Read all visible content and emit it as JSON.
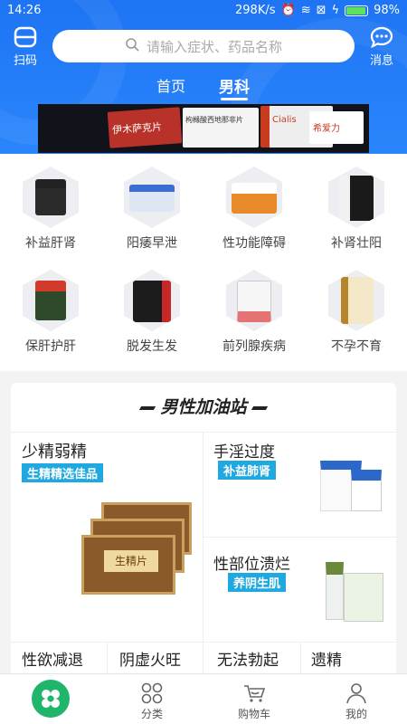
{
  "status": {
    "time": "14:26",
    "speed": "298K/s",
    "battery": "98%"
  },
  "header": {
    "scan_label": "扫码",
    "message_label": "消息",
    "search_placeholder": "请输入症状、药品名称"
  },
  "tabs": [
    {
      "label": "首页"
    },
    {
      "label": "男科"
    }
  ],
  "banner": {
    "product_1": "伊木萨克片",
    "product_2": "枸橼酸西地那非片",
    "product_3": "Cialis",
    "product_4": "希爱力"
  },
  "categories": [
    {
      "label": "补益肝肾"
    },
    {
      "label": "阳痿早泄"
    },
    {
      "label": "性功能障碍"
    },
    {
      "label": "补肾壮阳"
    },
    {
      "label": "保肝护肝"
    },
    {
      "label": "脱发生发"
    },
    {
      "label": "前列腺疾病"
    },
    {
      "label": "不孕不育"
    }
  ],
  "section": {
    "title": "男性加油站",
    "feature": {
      "title": "少精弱精",
      "badge": "生精精选佳品",
      "box_label": "生精片"
    },
    "items": [
      {
        "title": "手淫过度",
        "badge": "补益肺肾"
      },
      {
        "title": "性部位溃烂",
        "badge": "养阴生肌"
      }
    ],
    "bottom": [
      {
        "title": "性欲减退"
      },
      {
        "title": "阴虚火旺"
      },
      {
        "title": "无法勃起"
      },
      {
        "title": "遗精"
      }
    ]
  },
  "nav": [
    {
      "label": ""
    },
    {
      "label": "分类"
    },
    {
      "label": "购物车"
    },
    {
      "label": "我的"
    }
  ],
  "colors": {
    "header": "#1e74f4",
    "badge": "#20a8e0",
    "logo": "#1fb56b"
  }
}
